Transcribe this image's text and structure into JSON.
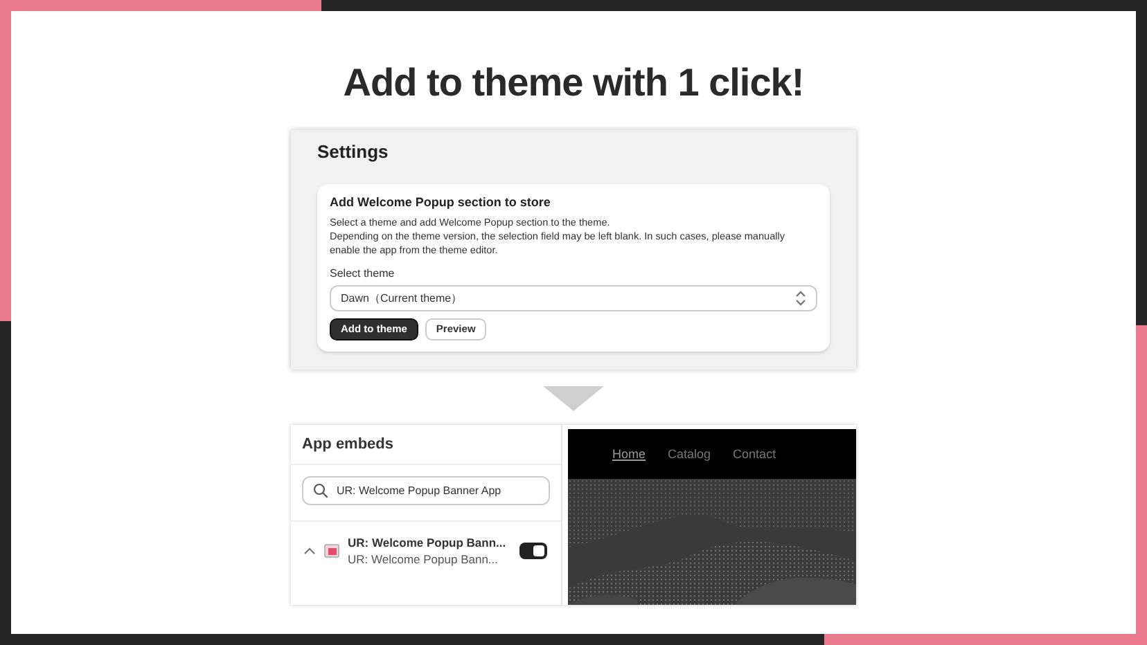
{
  "headline": "Add to theme with 1 click!",
  "settings": {
    "title": "Settings",
    "card_title": "Add Welcome Popup section to store",
    "description": "Select a theme and add Welcome Popup section to the theme.\nDepending on the theme version, the selection field may be left blank. In such cases, please manually enable the app from the theme editor.",
    "select_label": "Select theme",
    "select_value": "Dawn（Current theme）",
    "buttons": [
      {
        "label": "Add to theme",
        "kind": "primary"
      },
      {
        "label": "Preview",
        "kind": "secondary"
      }
    ]
  },
  "app_embeds": {
    "title": "App embeds",
    "search": {
      "value": "UR: Welcome Popup Banner App"
    },
    "item": {
      "title": "UR: Welcome Popup Bann...",
      "subtitle": "UR: Welcome Popup Bann...",
      "expanded": true,
      "on": true
    }
  },
  "preview": {
    "nav": [
      {
        "label": "Home",
        "selected": true
      },
      {
        "label": "Catalog",
        "selected": false
      },
      {
        "label": "Contact",
        "selected": false
      }
    ]
  }
}
